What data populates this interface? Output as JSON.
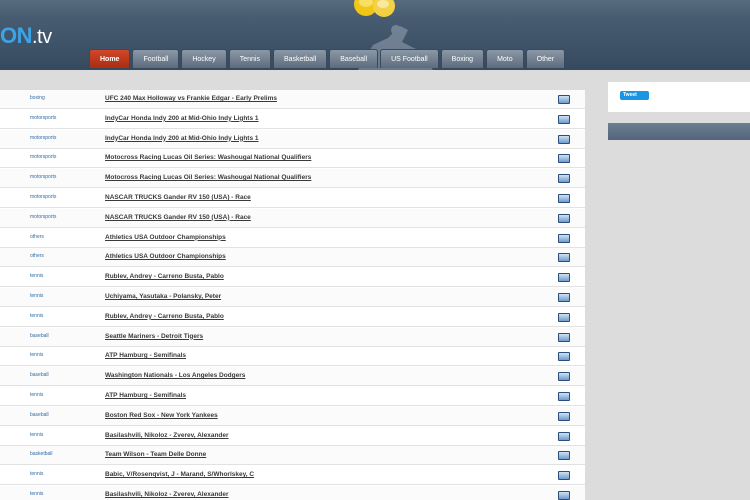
{
  "header": {
    "logo_main": "ON",
    "logo_tld": ".tv"
  },
  "nav": {
    "tabs": [
      {
        "label": "Home",
        "active": true
      },
      {
        "label": "Football"
      },
      {
        "label": "Hockey"
      },
      {
        "label": "Tennis"
      },
      {
        "label": "Basketball"
      },
      {
        "label": "Baseball"
      },
      {
        "label": "US Football"
      },
      {
        "label": "Boxing"
      },
      {
        "label": "Moto"
      },
      {
        "label": "Other"
      }
    ]
  },
  "events": [
    {
      "category": "boxing",
      "title": "UFC 240 Max Holloway vs Frankie Edgar - Early Prelims"
    },
    {
      "category": "motorsports",
      "title": "IndyCar Honda Indy 200 at Mid-Ohio Indy Lights 1"
    },
    {
      "category": "motorsports",
      "title": "IndyCar Honda Indy 200 at Mid-Ohio Indy Lights 1"
    },
    {
      "category": "motorsports",
      "title": "Motocross Racing Lucas Oil Series: Washougal National Qualifiers"
    },
    {
      "category": "motorsports",
      "title": "Motocross Racing Lucas Oil Series: Washougal National Qualifiers"
    },
    {
      "category": "motorsports",
      "title": "NASCAR TRUCKS Gander RV 150 (USA) - Race"
    },
    {
      "category": "motorsports",
      "title": "NASCAR TRUCKS Gander RV 150 (USA) - Race"
    },
    {
      "category": "others",
      "title": "Athletics USA Outdoor Championships"
    },
    {
      "category": "others",
      "title": "Athletics USA Outdoor Championships"
    },
    {
      "category": "tennis",
      "title": "Rublev, Andrey - Carreno Busta, Pablo"
    },
    {
      "category": "tennis",
      "title": "Uchiyama, Yasutaka - Polansky, Peter"
    },
    {
      "category": "tennis",
      "title": "Rublev, Andrey - Carreno Busta, Pablo"
    },
    {
      "category": "baseball",
      "title": "Seattle Mariners - Detroit Tigers"
    },
    {
      "category": "tennis",
      "title": "ATP Hamburg - Semifinals"
    },
    {
      "category": "baseball",
      "title": "Washington Nationals - Los Angeles Dodgers"
    },
    {
      "category": "tennis",
      "title": "ATP Hamburg - Semifinals"
    },
    {
      "category": "baseball",
      "title": "Boston Red Sox - New York Yankees"
    },
    {
      "category": "tennis",
      "title": "Basilashvili, Nikoloz - Zverev, Alexander"
    },
    {
      "category": "basketball",
      "title": "Team Wilson - Team Delle Donne"
    },
    {
      "category": "tennis",
      "title": "Babic, V/Rosenqvist, J - Marand, S/Whorlskey, C"
    },
    {
      "category": "tennis",
      "title": "Basilashvili, Nikoloz - Zverev, Alexander"
    }
  ],
  "sidebar": {
    "tweet_label": "Tweet"
  },
  "colors": {
    "accent": "#d2472a",
    "header": "#3f5369",
    "link_category": "#2f6aa8"
  }
}
